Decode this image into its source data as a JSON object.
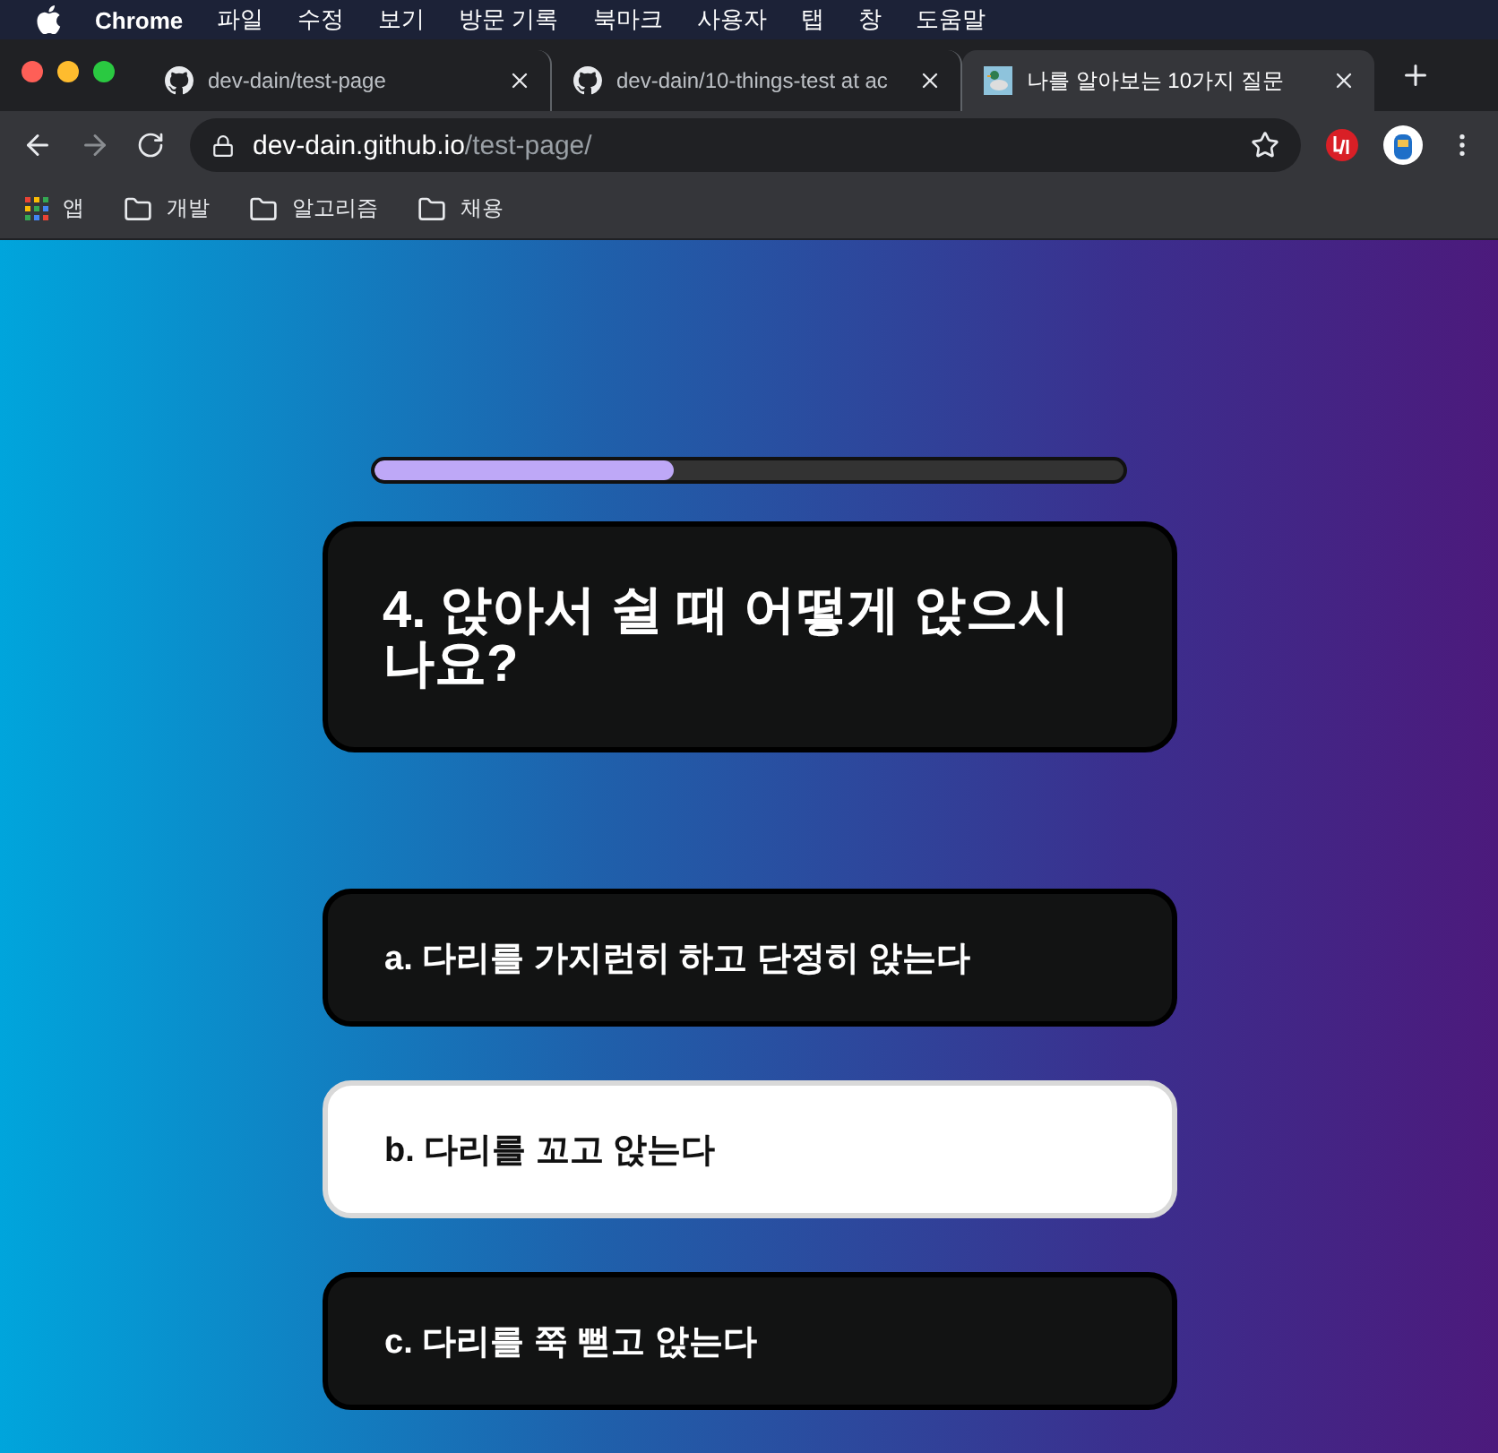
{
  "menu_bar": {
    "app": "Chrome",
    "items": [
      "파일",
      "수정",
      "보기",
      "방문 기록",
      "북마크",
      "사용자",
      "탭",
      "창",
      "도움말"
    ]
  },
  "tabs": [
    {
      "title": "dev-dain/test-page",
      "kind": "github",
      "selected": false
    },
    {
      "title": "dev-dain/10-things-test at ac",
      "kind": "github",
      "selected": false
    },
    {
      "title": "나를 알아보는 10가지 질문",
      "kind": "duck",
      "selected": true
    }
  ],
  "address_bar": {
    "host": "dev-dain.github.io",
    "path": "/test-page/"
  },
  "bookmarks": [
    {
      "label": "앱",
      "kind": "apps"
    },
    {
      "label": "개발",
      "kind": "folder"
    },
    {
      "label": "알고리즘",
      "kind": "folder"
    },
    {
      "label": "채용",
      "kind": "folder"
    }
  ],
  "quiz": {
    "progress": {
      "level": 0.4
    },
    "question": "4. 앉아서 쉴 때 어떻게 앉으시나요?",
    "options": [
      {
        "text": "a. 다리를 가지런히 하고 단정히 앉는다",
        "selected": false
      },
      {
        "text": "b. 다리를 꼬고 앉는다",
        "selected": true
      },
      {
        "text": "c. 다리를 쭉 뻗고 앉는다",
        "selected": false
      }
    ]
  }
}
